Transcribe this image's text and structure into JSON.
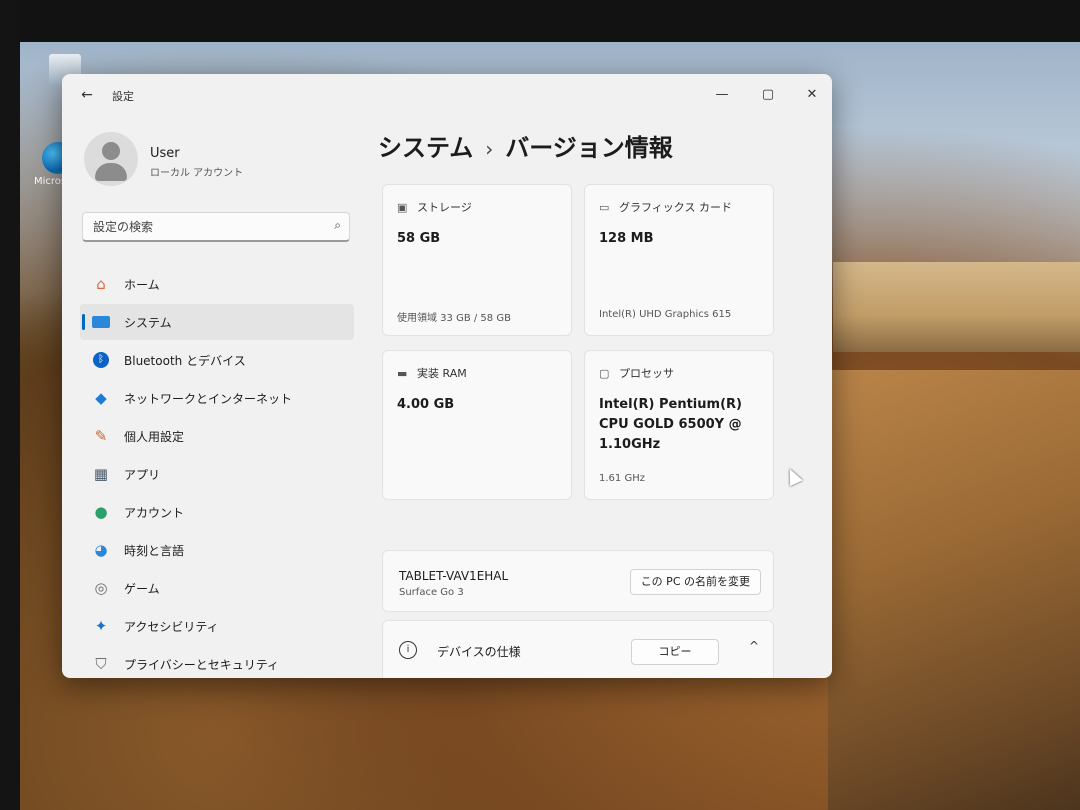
{
  "desktop": {
    "icons": [
      {
        "name": "recycle-bin",
        "label": ""
      },
      {
        "name": "edge",
        "label": "Micros"
      }
    ]
  },
  "window": {
    "title": "設定",
    "controls": {
      "minimize": "—",
      "maximize": "▢",
      "close": "✕"
    }
  },
  "user": {
    "name": "User",
    "account_type": "ローカル アカウント"
  },
  "search": {
    "placeholder": "設定の検索"
  },
  "nav": {
    "items": [
      {
        "label": "ホーム",
        "icon": "home-icon"
      },
      {
        "label": "システム",
        "icon": "system-icon",
        "active": true
      },
      {
        "label": "Bluetooth とデバイス",
        "icon": "bluetooth-icon"
      },
      {
        "label": "ネットワークとインターネット",
        "icon": "network-icon"
      },
      {
        "label": "個人用設定",
        "icon": "brush-icon"
      },
      {
        "label": "アプリ",
        "icon": "apps-icon"
      },
      {
        "label": "アカウント",
        "icon": "account-icon"
      },
      {
        "label": "時刻と言語",
        "icon": "globe-icon"
      },
      {
        "label": "ゲーム",
        "icon": "gamepad-icon"
      },
      {
        "label": "アクセシビリティ",
        "icon": "accessibility-icon"
      },
      {
        "label": "プライバシーとセキュリティ",
        "icon": "shield-icon"
      }
    ]
  },
  "page": {
    "breadcrumb_parent": "システム",
    "breadcrumb_separator": "›",
    "breadcrumb_current": "バージョン情報"
  },
  "cards": {
    "storage": {
      "title": "ストレージ",
      "value": "58 GB",
      "detail": "使用領域 33 GB / 58 GB"
    },
    "graphics": {
      "title": "グラフィックス カード",
      "value": "128 MB",
      "detail": "Intel(R) UHD Graphics 615"
    },
    "ram": {
      "title": "実装 RAM",
      "value": "4.00 GB"
    },
    "processor": {
      "title": "プロセッサ",
      "value_line1": "Intel(R) Pentium(R)",
      "value_line2": "CPU GOLD 6500Y @",
      "value_line3": "1.10GHz",
      "detail": "1.61 GHz"
    }
  },
  "pc": {
    "name": "TABLET-VAV1EHAL",
    "model": "Surface Go 3",
    "rename_button": "この PC の名前を変更"
  },
  "device_specs": {
    "label": "デバイスの仕様",
    "copy_button": "コピー",
    "info_glyph": "i",
    "chevron": "^"
  },
  "colors": {
    "accent": "#0067c0"
  }
}
